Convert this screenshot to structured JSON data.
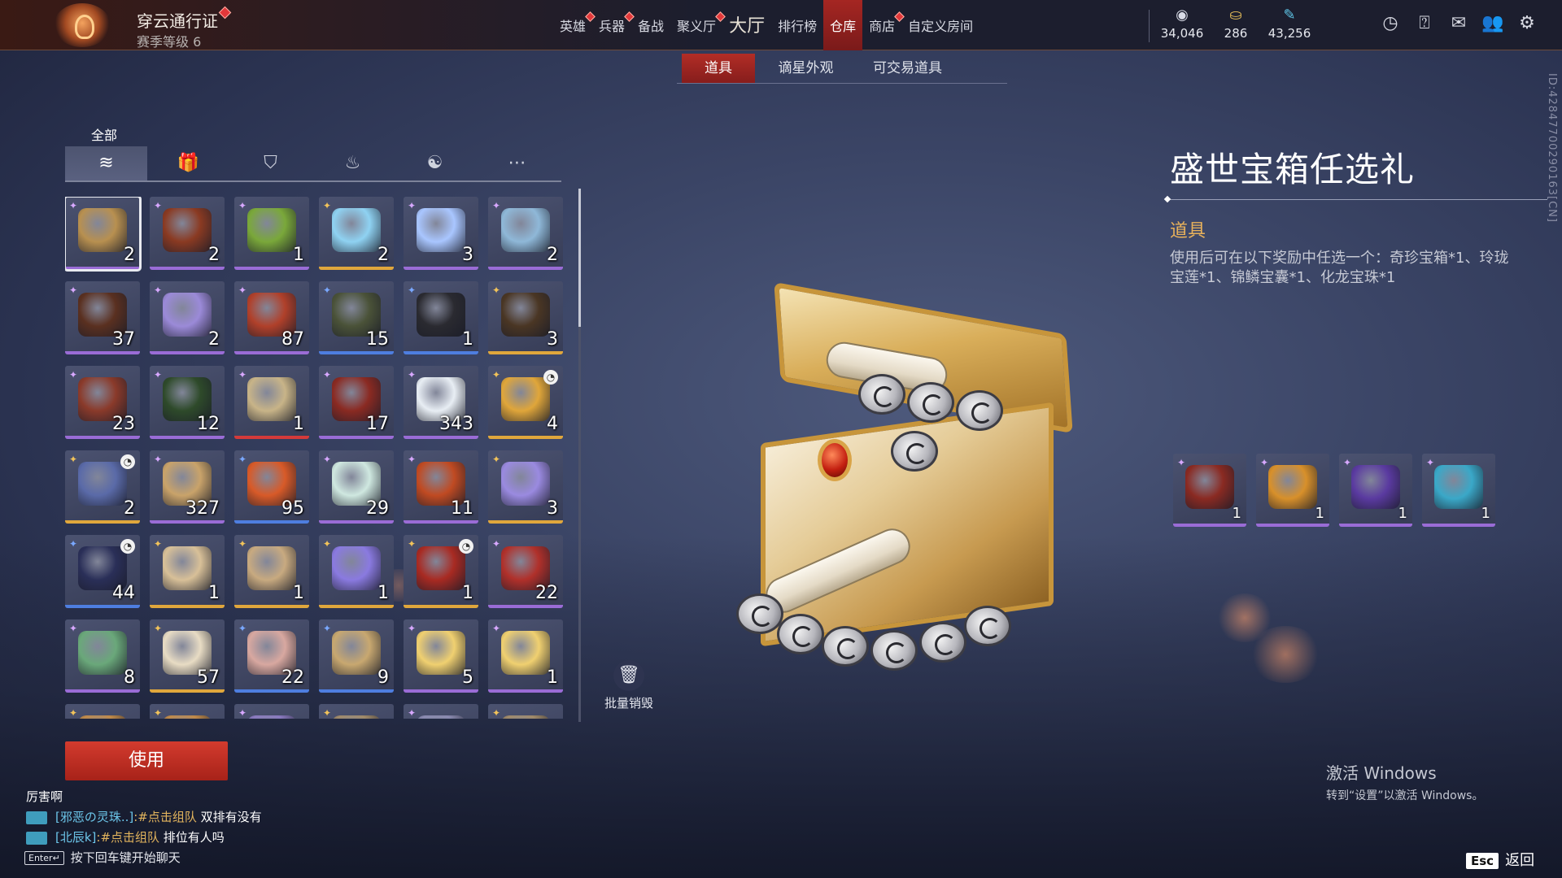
{
  "pass": {
    "title": "穿云通行证",
    "subtitle": "赛季等级 6"
  },
  "nav": {
    "items": [
      {
        "label": "英雄",
        "badge": true,
        "active": false,
        "big": false
      },
      {
        "label": "兵器",
        "badge": true,
        "active": false,
        "big": false
      },
      {
        "label": "备战",
        "badge": false,
        "active": false,
        "big": false
      },
      {
        "label": "聚义厅",
        "badge": true,
        "active": false,
        "big": false
      },
      {
        "label": "大厅",
        "badge": false,
        "active": false,
        "big": true
      },
      {
        "label": "排行榜",
        "badge": false,
        "active": false,
        "big": false
      },
      {
        "label": "仓库",
        "badge": false,
        "active": true,
        "big": false
      },
      {
        "label": "商店",
        "badge": true,
        "active": false,
        "big": false
      },
      {
        "label": "自定义房间",
        "badge": false,
        "active": false,
        "big": false
      }
    ]
  },
  "currencies": [
    {
      "icon": "coin-stack-icon",
      "value": "34,046"
    },
    {
      "icon": "gold-ingot-icon",
      "value": "286"
    },
    {
      "icon": "feather-icon",
      "value": "43,256"
    }
  ],
  "subtabs": [
    {
      "label": "道具",
      "active": true
    },
    {
      "label": "谪星外观",
      "active": false
    },
    {
      "label": "可交易道具",
      "active": false
    }
  ],
  "inventory": {
    "category_label": "全部",
    "filters": [
      "layers-icon",
      "gift-icon",
      "badge-icon",
      "flame-icon",
      "swirl-icon",
      "more-icon"
    ],
    "items": [
      {
        "count": "2",
        "rarity": "purple",
        "color": "#b89050",
        "selected": true,
        "clock": false
      },
      {
        "count": "2",
        "rarity": "purple",
        "color": "#8a3a22",
        "selected": false,
        "clock": false
      },
      {
        "count": "1",
        "rarity": "purple",
        "color": "#7aa83a",
        "selected": false,
        "clock": false
      },
      {
        "count": "2",
        "rarity": "gold",
        "color": "#8fd2f2",
        "selected": false,
        "clock": false
      },
      {
        "count": "3",
        "rarity": "purple",
        "color": "#a9c6ff",
        "selected": false,
        "clock": false
      },
      {
        "count": "2",
        "rarity": "purple",
        "color": "#8fb8d8",
        "selected": false,
        "clock": false
      },
      {
        "count": "37",
        "rarity": "purple",
        "color": "#5a3020",
        "selected": false,
        "clock": false
      },
      {
        "count": "2",
        "rarity": "purple",
        "color": "#9b8ad8",
        "selected": false,
        "clock": false
      },
      {
        "count": "87",
        "rarity": "purple",
        "color": "#b0402a",
        "selected": false,
        "clock": false
      },
      {
        "count": "15",
        "rarity": "blue",
        "color": "#4a5238",
        "selected": false,
        "clock": false
      },
      {
        "count": "1",
        "rarity": "blue",
        "color": "#2a2a30",
        "selected": false,
        "clock": false
      },
      {
        "count": "3",
        "rarity": "gold",
        "color": "#4a3624",
        "selected": false,
        "clock": false
      },
      {
        "count": "23",
        "rarity": "purple",
        "color": "#8a3a2a",
        "selected": false,
        "clock": false
      },
      {
        "count": "12",
        "rarity": "purple",
        "color": "#2e4a2a",
        "selected": false,
        "clock": false
      },
      {
        "count": "1",
        "rarity": "red",
        "color": "#c8b488",
        "selected": false,
        "clock": false
      },
      {
        "count": "17",
        "rarity": "purple",
        "color": "#8a2a22",
        "selected": false,
        "clock": false
      },
      {
        "count": "343",
        "rarity": "purple",
        "color": "#e8eef4",
        "selected": false,
        "clock": false
      },
      {
        "count": "4",
        "rarity": "gold",
        "color": "#e0a63a",
        "selected": false,
        "clock": true
      },
      {
        "count": "2",
        "rarity": "gold",
        "color": "#5a6aa8",
        "selected": false,
        "clock": true
      },
      {
        "count": "327",
        "rarity": "purple",
        "color": "#c9a36a",
        "selected": false,
        "clock": false
      },
      {
        "count": "95",
        "rarity": "blue",
        "color": "#d85a28",
        "selected": false,
        "clock": false
      },
      {
        "count": "29",
        "rarity": "purple",
        "color": "#cfe8e0",
        "selected": false,
        "clock": false
      },
      {
        "count": "11",
        "rarity": "purple",
        "color": "#c04a22",
        "selected": false,
        "clock": false
      },
      {
        "count": "3",
        "rarity": "gold",
        "color": "#9a8ae0",
        "selected": false,
        "clock": false
      },
      {
        "count": "44",
        "rarity": "blue",
        "color": "#2a2f58",
        "selected": false,
        "clock": true
      },
      {
        "count": "1",
        "rarity": "gold",
        "color": "#d8c098",
        "selected": false,
        "clock": false
      },
      {
        "count": "1",
        "rarity": "gold",
        "color": "#c8aa80",
        "selected": false,
        "clock": false
      },
      {
        "count": "1",
        "rarity": "gold",
        "color": "#8a7ae0",
        "selected": false,
        "clock": false
      },
      {
        "count": "1",
        "rarity": "gold",
        "color": "#a82a22",
        "selected": false,
        "clock": true
      },
      {
        "count": "22",
        "rarity": "purple",
        "color": "#b0302a",
        "selected": false,
        "clock": false
      },
      {
        "count": "8",
        "rarity": "purple",
        "color": "#6aa87a",
        "selected": false,
        "clock": false
      },
      {
        "count": "57",
        "rarity": "gold",
        "color": "#e8dcc4",
        "selected": false,
        "clock": false
      },
      {
        "count": "22",
        "rarity": "blue",
        "color": "#d8a8a0",
        "selected": false,
        "clock": false
      },
      {
        "count": "9",
        "rarity": "blue",
        "color": "#c8a870",
        "selected": false,
        "clock": false
      },
      {
        "count": "5",
        "rarity": "purple",
        "color": "#f0d070",
        "selected": false,
        "clock": false
      },
      {
        "count": "1",
        "rarity": "purple",
        "color": "#f0d070",
        "selected": false,
        "clock": false
      },
      {
        "count": "",
        "rarity": "gold",
        "color": "#c08a4a",
        "selected": false,
        "clock": false
      },
      {
        "count": "",
        "rarity": "gold",
        "color": "#c08a4a",
        "selected": false,
        "clock": false
      },
      {
        "count": "",
        "rarity": "purple",
        "color": "#8a7ac0",
        "selected": false,
        "clock": false
      },
      {
        "count": "",
        "rarity": "gold",
        "color": "#a08a6a",
        "selected": false,
        "clock": false
      },
      {
        "count": "",
        "rarity": "purple",
        "color": "#8a8ab0",
        "selected": false,
        "clock": false
      },
      {
        "count": "",
        "rarity": "gold",
        "color": "#a08a6a",
        "selected": false,
        "clock": false
      }
    ]
  },
  "actions": {
    "use_label": "使用",
    "destroy_label": "批量销毁"
  },
  "chat": {
    "title": "厉害啊",
    "lines": [
      {
        "name": "[邪恶の灵珠..]",
        "link": ":#点击组队",
        "text": " 双排有没有"
      },
      {
        "name": "[北辰k]",
        "link": ":#点击组队",
        "text": " 排位有人吗"
      }
    ],
    "hint_key": "Enter↵",
    "hint": "按下回车键开始聊天"
  },
  "detail": {
    "title": "盛世宝箱任选礼",
    "type": "道具",
    "description": "使用后可在以下奖励中任选一个：奇珍宝箱*1、玲珑宝莲*1、锦鳞宝囊*1、化龙宝珠*1",
    "rewards": [
      {
        "count": "1",
        "color": "#8a2a22"
      },
      {
        "count": "1",
        "color": "#d8902a"
      },
      {
        "count": "1",
        "color": "#5a3aa0"
      },
      {
        "count": "1",
        "color": "#3aa8c8"
      }
    ]
  },
  "vertical_id": "ID:42847700290163[CN]",
  "watermark": {
    "title": "激活 Windows",
    "subtitle": "转到“设置”以激活 Windows。"
  },
  "back": {
    "key": "Esc",
    "label": "返回"
  }
}
